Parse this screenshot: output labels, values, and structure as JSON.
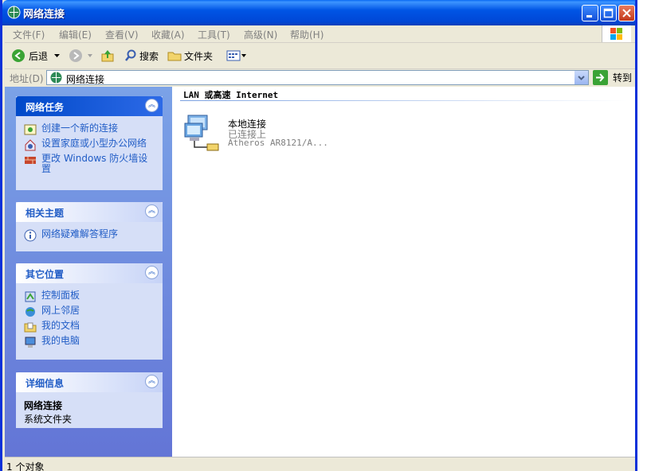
{
  "window": {
    "title": "网络连接"
  },
  "menu": [
    {
      "label": "文件(F)"
    },
    {
      "label": "编辑(E)"
    },
    {
      "label": "查看(V)"
    },
    {
      "label": "收藏(A)"
    },
    {
      "label": "工具(T)"
    },
    {
      "label": "高级(N)"
    },
    {
      "label": "帮助(H)"
    }
  ],
  "toolbar": {
    "back_label": "后退",
    "search_label": "搜索",
    "folders_label": "文件夹"
  },
  "address": {
    "label": "地址(D)",
    "value": "网络连接",
    "go_label": "转到"
  },
  "sidebar": {
    "network_tasks": {
      "title": "网络任务",
      "items": [
        {
          "label": "创建一个新的连接"
        },
        {
          "label": "设置家庭或小型办公网络"
        },
        {
          "label": "更改 Windows 防火墙设置"
        }
      ]
    },
    "related": {
      "title": "相关主题",
      "items": [
        {
          "label": "网络疑难解答程序"
        }
      ]
    },
    "other_places": {
      "title": "其它位置",
      "items": [
        {
          "label": "控制面板"
        },
        {
          "label": "网上邻居"
        },
        {
          "label": "我的文档"
        },
        {
          "label": "我的电脑"
        }
      ]
    },
    "details": {
      "title": "详细信息",
      "name": "网络连接",
      "type": "系统文件夹"
    }
  },
  "content": {
    "group_header": "LAN 或高速 Internet",
    "connections": [
      {
        "name": "本地连接",
        "status": "已连接上",
        "device": "Atheros AR8121/A..."
      }
    ]
  },
  "status": {
    "text": "1 个对象"
  },
  "colors": {
    "title_bar": "#0055e5",
    "sidebar": "#6f8ede",
    "link": "#215dc6",
    "panel_body": "#d6dff7"
  }
}
